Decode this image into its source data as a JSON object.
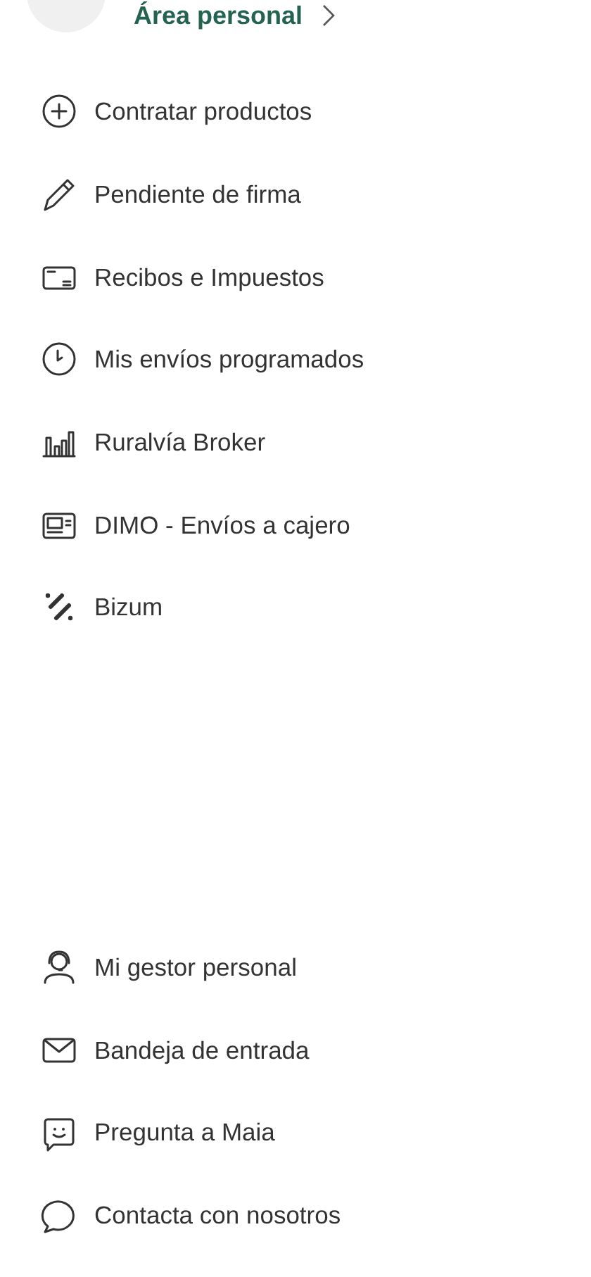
{
  "header": {
    "title": "Área personal"
  },
  "menu": [
    {
      "label": "Contratar productos",
      "kind": "plus"
    },
    {
      "label": "Pendiente de firma",
      "kind": "pen"
    },
    {
      "label": "Recibos e Impuestos",
      "kind": "receipt"
    },
    {
      "label": "Mis envíos programados",
      "kind": "clock"
    },
    {
      "label": "Ruralvía Broker",
      "kind": "bars"
    },
    {
      "label": "DIMO - Envíos a cajero",
      "kind": "atm"
    },
    {
      "label": "Bizum",
      "kind": "bizum"
    }
  ],
  "support": [
    {
      "label": "Mi gestor personal",
      "kind": "headset"
    },
    {
      "label": "Bandeja de entrada",
      "kind": "mail"
    },
    {
      "label": "Pregunta a Maia",
      "kind": "chat-smile"
    },
    {
      "label": "Contacta con nosotros",
      "kind": "chat"
    }
  ]
}
